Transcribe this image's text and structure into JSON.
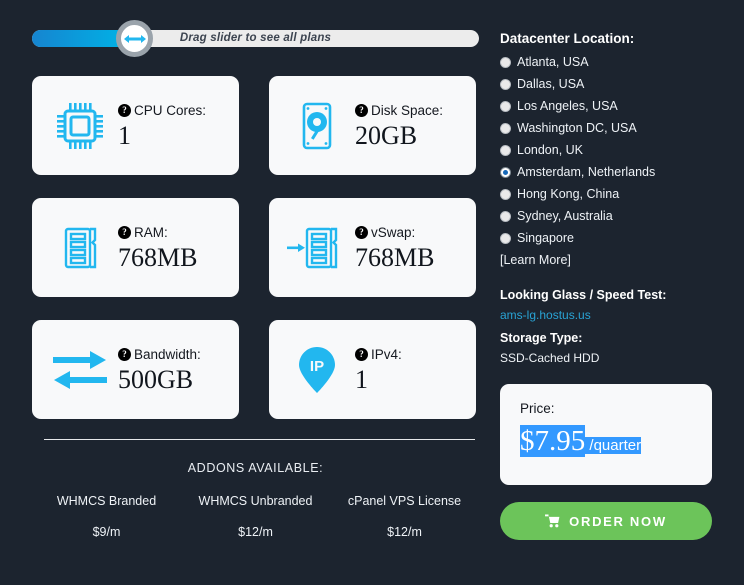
{
  "theme": {
    "background": "#1c242f",
    "card_bg": "#f8f9fa",
    "accent_cyan": "#22b7ef",
    "accent_blue": "#1685d0",
    "selection_blue": "#3399ff",
    "order_green": "#6cc45a",
    "link_blue": "#29a3d4"
  },
  "slider": {
    "label": "Drag slider to see all plans",
    "handle_icon": "left-right-arrow-icon",
    "fill_percent": 21
  },
  "specs": [
    {
      "icon": "cpu-chip-icon",
      "label": "CPU Cores:",
      "value": "1",
      "help": "?"
    },
    {
      "icon": "hard-drive-icon",
      "label": "Disk Space:",
      "value": "20GB",
      "help": "?"
    },
    {
      "icon": "ram-stick-icon",
      "label": "RAM:",
      "value": "768MB",
      "help": "?"
    },
    {
      "icon": "vswap-arrow-ram-icon",
      "label": "vSwap:",
      "value": "768MB",
      "help": "?"
    },
    {
      "icon": "bandwidth-arrows-icon",
      "label": "Bandwidth:",
      "value": "500GB",
      "help": "?"
    },
    {
      "icon": "ip-map-pin-icon",
      "label": "IPv4:",
      "value": "1",
      "help": "?"
    }
  ],
  "addons": {
    "title": "ADDONS AVAILABLE:",
    "items": [
      {
        "name": "WHMCS Branded",
        "price": "$9/m"
      },
      {
        "name": "WHMCS Unbranded",
        "price": "$12/m"
      },
      {
        "name": "cPanel VPS License",
        "price": "$12/m"
      }
    ]
  },
  "datacenter": {
    "title": "Datacenter Location:",
    "options": [
      {
        "label": "Atlanta, USA",
        "selected": false
      },
      {
        "label": "Dallas, USA",
        "selected": false
      },
      {
        "label": "Los Angeles, USA",
        "selected": false
      },
      {
        "label": "Washington DC, USA",
        "selected": false
      },
      {
        "label": "London, UK",
        "selected": false
      },
      {
        "label": "Amsterdam, Netherlands",
        "selected": true
      },
      {
        "label": "Hong Kong, China",
        "selected": false
      },
      {
        "label": "Sydney, Australia",
        "selected": false
      },
      {
        "label": "Singapore",
        "selected": false
      }
    ],
    "learn_more": "[Learn More]"
  },
  "looking_glass": {
    "title": "Looking Glass / Speed Test:",
    "link": "ams-lg.hostus.us"
  },
  "storage": {
    "title": "Storage Type:",
    "value": "SSD-Cached HDD"
  },
  "price": {
    "label": "Price:",
    "amount": "$7.95",
    "period": " /quarter"
  },
  "order": {
    "label": "ORDER NOW",
    "icon": "shopping-cart-icon"
  }
}
